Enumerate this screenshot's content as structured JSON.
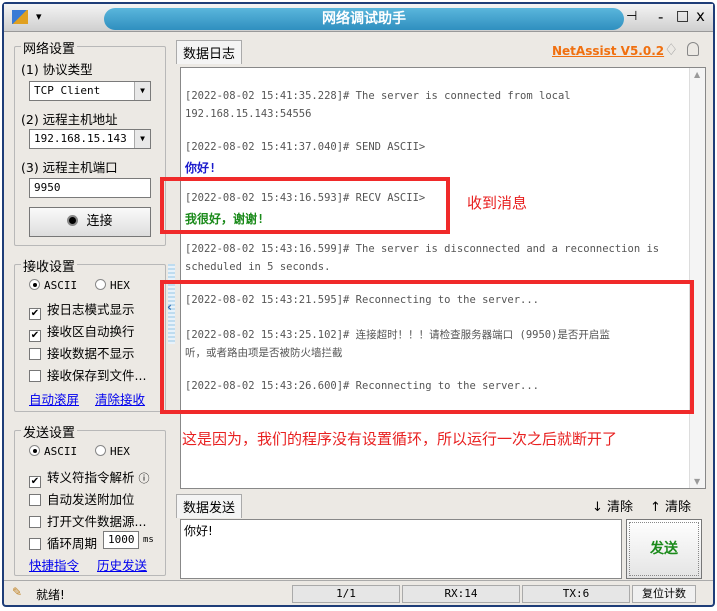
{
  "window": {
    "title": "网络调试助手",
    "menu_arrow": "▾",
    "pin": "⊣",
    "min": "-",
    "max": "□",
    "close": "x"
  },
  "header": {
    "tab_log": "数据日志",
    "version_link": "NetAssist V5.0.2",
    "diamond_icon": "♢",
    "bell_icon": "🔔"
  },
  "network": {
    "title": "网络设置",
    "protocol_label": "(1) 协议类型",
    "protocol_value": "TCP Client",
    "host_label": "(2) 远程主机地址",
    "host_value": "192.168.15.143",
    "port_label": "(3) 远程主机端口",
    "port_value": "9950",
    "connect_label": "连接"
  },
  "receive": {
    "title": "接收设置",
    "ascii": "ASCII",
    "hex": "HEX",
    "options": [
      {
        "label": "按日志模式显示",
        "checked": true
      },
      {
        "label": "接收区自动换行",
        "checked": true
      },
      {
        "label": "接收数据不显示",
        "checked": false
      },
      {
        "label": "接收保存到文件...",
        "checked": false
      }
    ],
    "link_autoscroll": "自动滚屏",
    "link_clear": "清除接收"
  },
  "send": {
    "title": "发送设置",
    "ascii": "ASCII",
    "hex": "HEX",
    "options": [
      {
        "label": "转义符指令解析",
        "checked": true
      },
      {
        "label": "自动发送附加位",
        "checked": false
      },
      {
        "label": "打开文件数据源...",
        "checked": false
      },
      {
        "label": "循环周期",
        "checked": false
      }
    ],
    "period_value": "1000",
    "period_unit": "ms",
    "link_shortcut": "快捷指令",
    "link_history": "历史发送"
  },
  "log": {
    "lines": [
      {
        "text": "[2022-08-02 15:41:35.228]# The server is connected from local",
        "color": "#555"
      },
      {
        "text": "192.168.15.143:54556",
        "color": "#555"
      },
      {
        "text": "[2022-08-02 15:41:37.040]# SEND ASCII>",
        "color": "#555"
      },
      {
        "text": "你好!",
        "color": "#1a1acc"
      },
      {
        "text": "[2022-08-02 15:43:16.593]# RECV ASCII>",
        "color": "#555"
      },
      {
        "text": "我很好，谢谢!",
        "color": "#1a8a1a"
      },
      {
        "text": "[2022-08-02 15:43:16.599]# The server is disconnected and a reconnection is",
        "color": "#555"
      },
      {
        "text": "scheduled in 5 seconds.",
        "color": "#555"
      },
      {
        "text": "[2022-08-02 15:43:21.595]# Reconnecting to the server...",
        "color": "#555"
      },
      {
        "text": "[2022-08-02 15:43:25.102]# 连接超时！！！请检查服务器端口 (9950)是否开启监",
        "color": "#555"
      },
      {
        "text": "听，或者路由项是否被防火墙拦截",
        "color": "#555"
      },
      {
        "text": "[2022-08-02 15:43:26.600]# Reconnecting to the server...",
        "color": "#555"
      }
    ]
  },
  "annotations": {
    "received": "收到消息",
    "explanation": "这是因为，我们的程序没有设置循环，所以运行一次之后就断开了"
  },
  "send_area": {
    "tab": "数据发送",
    "clear1": "清除",
    "clear2": "清除",
    "text": "你好!",
    "send_button": "发送"
  },
  "statusbar": {
    "status": "就绪!",
    "page": "1/1",
    "rx": "RX:14",
    "tx": "TX:6",
    "reset": "复位计数"
  },
  "colors": {
    "annotation": "#f02a2a",
    "version": "#f07010",
    "send_button": "#1a8a1a"
  }
}
